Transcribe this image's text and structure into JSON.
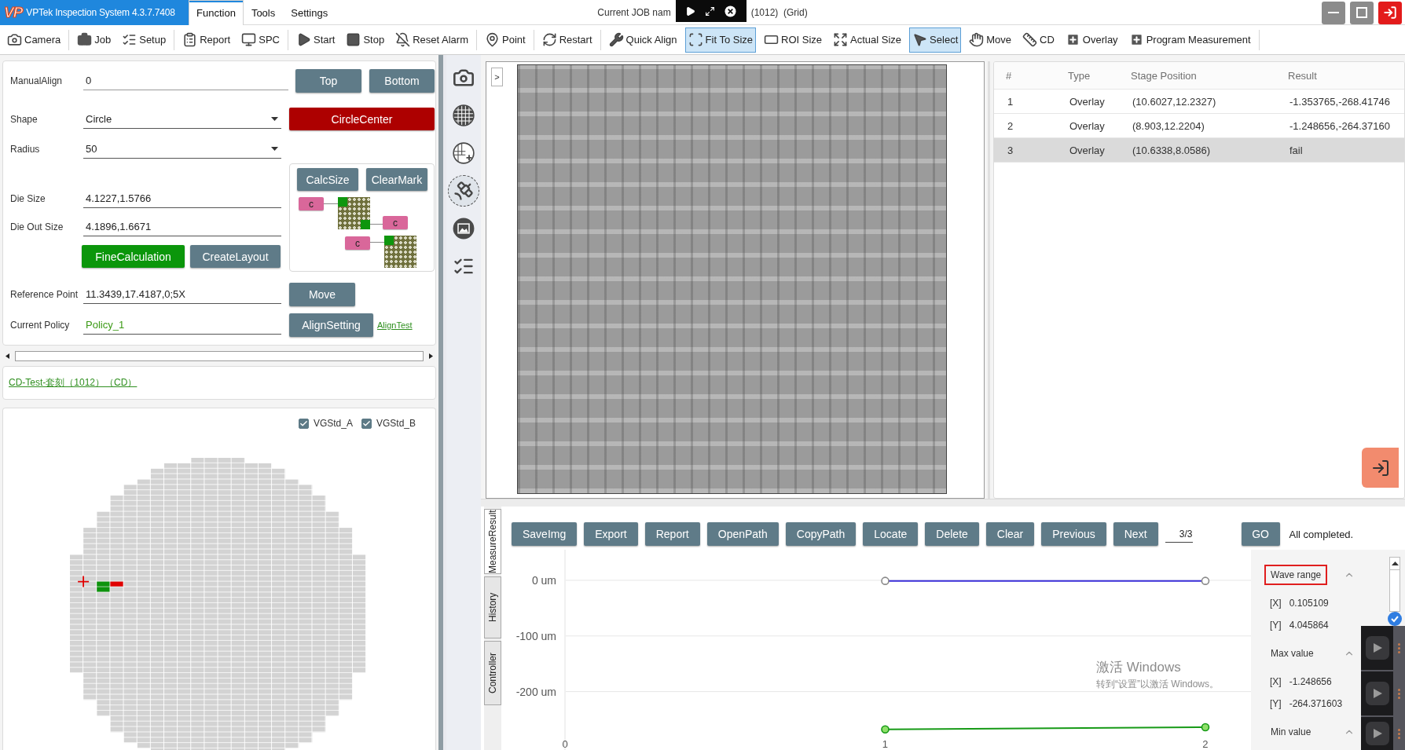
{
  "title_bar": {
    "logo": "VP",
    "app_name": "VPTek Inspection System 4.3.7.7408",
    "menu_tabs": [
      {
        "label": "Function",
        "selected": true
      },
      {
        "label": "Tools",
        "selected": false
      },
      {
        "label": "Settings",
        "selected": false
      }
    ],
    "job_title_start": "Current JOB nam",
    "job_title_end": "(1012)  (Grid)"
  },
  "toolbar": {
    "groups": [
      {
        "items": [
          {
            "label": "Camera",
            "selected": false
          }
        ]
      },
      {
        "items": [
          {
            "label": "Job",
            "selected": false
          },
          {
            "label": "Setup",
            "selected": false
          }
        ]
      },
      {
        "items": [
          {
            "label": "Report",
            "selected": false
          },
          {
            "label": "SPC",
            "selected": false
          }
        ]
      },
      {
        "items": [
          {
            "label": "Start",
            "selected": false
          },
          {
            "label": "Stop",
            "selected": false
          },
          {
            "label": "Reset Alarm",
            "selected": false
          }
        ]
      },
      {
        "items": [
          {
            "label": "Point",
            "selected": false
          }
        ]
      },
      {
        "items": [
          {
            "label": "Restart",
            "selected": false
          }
        ]
      },
      {
        "items": [
          {
            "label": "Quick Align",
            "selected": false
          },
          {
            "label": "Fit To Size",
            "selected": true
          },
          {
            "label": "ROI Size",
            "selected": false
          },
          {
            "label": "Actual Size",
            "selected": false
          },
          {
            "label": "Select",
            "selected": true
          },
          {
            "label": "Move",
            "selected": false
          },
          {
            "label": "CD",
            "selected": false
          },
          {
            "label": "Overlay",
            "selected": false
          },
          {
            "label": "Program Measurement",
            "selected": false
          }
        ]
      }
    ]
  },
  "align_panel": {
    "manual_align": {
      "label": "ManualAlign",
      "value": "0",
      "kind": "text"
    },
    "top_button": "Top",
    "bottom_button": "Bottom",
    "shape": {
      "label": "Shape",
      "value": "Circle",
      "kind": "dropdown"
    },
    "circle_center_button": "CircleCenter",
    "radius": {
      "label": "Radius",
      "value": "50",
      "kind": "dropdown"
    },
    "calc_size_button": "CalcSize",
    "clear_mark_button": "ClearMark",
    "layout_tags": [
      "c",
      "c",
      "c"
    ],
    "die_size": {
      "label": "Die Size",
      "value": "4.1227,1.5766",
      "kind": "text"
    },
    "die_out_size": {
      "label": "Die Out Size",
      "value": "4.1896,1.6671",
      "kind": "text"
    },
    "fine_calculation_button": "FineCalculation",
    "create_layout_button": "CreateLayout",
    "reference_point": {
      "label": "Reference Point",
      "value": "11.3439,17.4187,0;5X",
      "kind": "text"
    },
    "move_button": "Move",
    "current_policy": {
      "label": "Current Policy",
      "value": "Policy_1",
      "kind": "status"
    },
    "align_setting_button": "AlignSetting",
    "align_test_link": "AlignTest"
  },
  "job_link": "CD-Test-套刻（1012）（CD）",
  "wafer_map": {
    "checkboxes": [
      {
        "label": "VGStd_A",
        "checked": true
      },
      {
        "label": "VGStd_B",
        "checked": true
      }
    ]
  },
  "icon_sidebar": [
    {
      "selected": false
    },
    {
      "selected": false
    },
    {
      "selected": false
    },
    {
      "selected": true
    },
    {
      "selected": false
    },
    {
      "selected": false
    }
  ],
  "image_view": {
    "expand_button": ">"
  },
  "table": {
    "columns": [
      "#",
      "Type",
      "Stage Position",
      "Result"
    ],
    "rows": [
      {
        "cells": [
          "1",
          "Overlay",
          "(10.6027,12.2327)",
          "-1.353765,-268.41746"
        ],
        "selected": false
      },
      {
        "cells": [
          "2",
          "Overlay",
          "(8.903,12.2204)",
          "-1.248656,-264.37160"
        ],
        "selected": false
      },
      {
        "cells": [
          "3",
          "Overlay",
          "(10.6338,8.0586)",
          "fail"
        ],
        "selected": true
      }
    ]
  },
  "result_tabs": [
    {
      "label": "MeasureResult",
      "selected": true
    },
    {
      "label": "History",
      "selected": false
    },
    {
      "label": "Controller",
      "selected": false
    }
  ],
  "results": {
    "buttons": [
      "SaveImg",
      "Export",
      "Report",
      "OpenPath",
      "CopyPath",
      "Locate",
      "Delete",
      "Clear",
      "Previous",
      "Next"
    ],
    "page": "3/3",
    "go_button": "GO",
    "status": "All completed.",
    "chart_data": {
      "type": "line",
      "grid": true,
      "x": [
        1,
        2
      ],
      "series": [
        {
          "color": "#3a2ed8",
          "marker": "circle",
          "values": [
            -1,
            -1
          ]
        },
        {
          "color": "#169a16",
          "marker": "circle",
          "values": [
            -268,
            -264
          ]
        }
      ],
      "xlim": [
        0,
        2.62
      ],
      "ylim": [
        -305,
        55
      ],
      "xticks": [
        0,
        1,
        2
      ],
      "yticks": [
        {
          "value": 0,
          "label": "0 um"
        },
        {
          "value": -100,
          "label": "-100 um"
        },
        {
          "value": -200,
          "label": "-200 um"
        }
      ]
    }
  },
  "summary": {
    "sections": [
      {
        "title": "Wave range",
        "highlighted": true,
        "expanded": true,
        "rows": [
          {
            "key": "[X]",
            "value": "0.105109"
          },
          {
            "key": "[Y]",
            "value": "4.045864"
          }
        ]
      },
      {
        "title": "Max value",
        "highlighted": false,
        "expanded": true,
        "rows": [
          {
            "key": "[X]",
            "value": "-1.248656"
          },
          {
            "key": "[Y]",
            "value": "-264.371603"
          }
        ]
      },
      {
        "title": "Min value",
        "highlighted": false,
        "expanded": true
      }
    ]
  },
  "system_overlay": {
    "watermark": [
      "激活 Windows",
      "转到“设置”以激活 Windows。"
    ]
  }
}
